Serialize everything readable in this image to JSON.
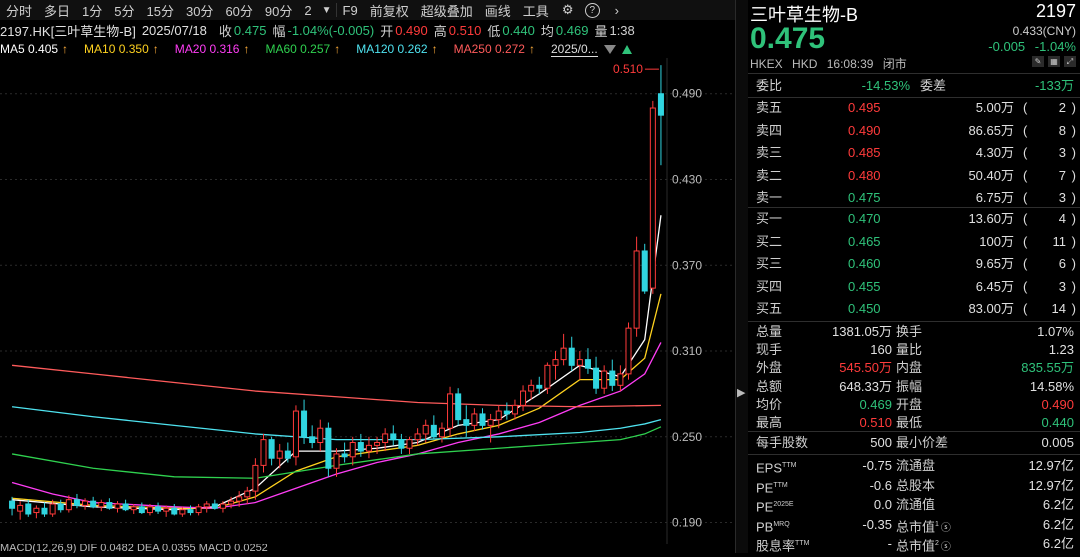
{
  "toolbar": {
    "items": [
      "分时",
      "多日",
      "1分",
      "5分",
      "15分",
      "30分",
      "60分",
      "90分",
      "2"
    ],
    "right_items": [
      "F9",
      "前复权",
      "超级叠加",
      "画线",
      "工具"
    ],
    "icons": [
      "gear-icon",
      "help-icon",
      "chevron-right-icon"
    ]
  },
  "info": {
    "symbol": "2197.HK[三叶草生物-B]",
    "date": "2025/07/18",
    "close_label": "收",
    "close": "0.475",
    "chg_label": "幅",
    "chg": "-1.04%(-0.005)",
    "open_label": "开",
    "open": "0.490",
    "high_label": "高",
    "high": "0.510",
    "low_label": "低",
    "low": "0.440",
    "avg_label": "均",
    "avg": "0.469",
    "vol_label": "量",
    "vol": "1:38"
  },
  "ma": [
    {
      "label": "MA5 0.405",
      "color": "#ffffff"
    },
    {
      "label": "MA10 0.350",
      "color": "#ffd21f"
    },
    {
      "label": "MA20 0.316",
      "color": "#ff3df5"
    },
    {
      "label": "MA60 0.257",
      "color": "#2fd14f"
    },
    {
      "label": "MA120 0.262",
      "color": "#4fe3f0"
    },
    {
      "label": "MA250 0.272",
      "color": "#ff5b5b"
    }
  ],
  "ma_arrow": "↑",
  "ma_date": "2025/0...",
  "macd_text": "MACD(12,26,9)  DIF 0.0482  DEA 0.0355  MACD 0.0252",
  "chart_data": {
    "type": "candlestick",
    "ylim": [
      0.175,
      0.515
    ],
    "yticks": [
      0.19,
      0.25,
      0.31,
      0.37,
      0.43,
      0.49
    ],
    "ytick_labels": [
      "0.190",
      "0.250",
      "0.310",
      "0.370",
      "0.430",
      "0.490"
    ],
    "high_label": "0.510",
    "up_color": "#ff3b3b",
    "down_color": "#30d5e0",
    "candles": [
      {
        "o": 0.205,
        "h": 0.208,
        "l": 0.195,
        "c": 0.2
      },
      {
        "o": 0.198,
        "h": 0.205,
        "l": 0.192,
        "c": 0.202
      },
      {
        "o": 0.203,
        "h": 0.206,
        "l": 0.194,
        "c": 0.196
      },
      {
        "o": 0.197,
        "h": 0.202,
        "l": 0.193,
        "c": 0.2
      },
      {
        "o": 0.2,
        "h": 0.204,
        "l": 0.194,
        "c": 0.196
      },
      {
        "o": 0.196,
        "h": 0.206,
        "l": 0.194,
        "c": 0.203
      },
      {
        "o": 0.203,
        "h": 0.206,
        "l": 0.197,
        "c": 0.199
      },
      {
        "o": 0.199,
        "h": 0.209,
        "l": 0.197,
        "c": 0.206
      },
      {
        "o": 0.206,
        "h": 0.21,
        "l": 0.2,
        "c": 0.202
      },
      {
        "o": 0.202,
        "h": 0.207,
        "l": 0.199,
        "c": 0.205
      },
      {
        "o": 0.205,
        "h": 0.208,
        "l": 0.2,
        "c": 0.201
      },
      {
        "o": 0.201,
        "h": 0.206,
        "l": 0.198,
        "c": 0.204
      },
      {
        "o": 0.204,
        "h": 0.207,
        "l": 0.199,
        "c": 0.2
      },
      {
        "o": 0.2,
        "h": 0.205,
        "l": 0.197,
        "c": 0.203
      },
      {
        "o": 0.203,
        "h": 0.206,
        "l": 0.198,
        "c": 0.199
      },
      {
        "o": 0.199,
        "h": 0.203,
        "l": 0.196,
        "c": 0.201
      },
      {
        "o": 0.201,
        "h": 0.204,
        "l": 0.196,
        "c": 0.197
      },
      {
        "o": 0.197,
        "h": 0.203,
        "l": 0.195,
        "c": 0.201
      },
      {
        "o": 0.201,
        "h": 0.204,
        "l": 0.196,
        "c": 0.198
      },
      {
        "o": 0.198,
        "h": 0.202,
        "l": 0.194,
        "c": 0.2
      },
      {
        "o": 0.2,
        "h": 0.203,
        "l": 0.195,
        "c": 0.196
      },
      {
        "o": 0.196,
        "h": 0.201,
        "l": 0.194,
        "c": 0.199
      },
      {
        "o": 0.199,
        "h": 0.202,
        "l": 0.195,
        "c": 0.197
      },
      {
        "o": 0.197,
        "h": 0.203,
        "l": 0.195,
        "c": 0.201
      },
      {
        "o": 0.201,
        "h": 0.205,
        "l": 0.197,
        "c": 0.203
      },
      {
        "o": 0.203,
        "h": 0.206,
        "l": 0.199,
        "c": 0.2
      },
      {
        "o": 0.2,
        "h": 0.205,
        "l": 0.197,
        "c": 0.203
      },
      {
        "o": 0.203,
        "h": 0.208,
        "l": 0.2,
        "c": 0.205
      },
      {
        "o": 0.205,
        "h": 0.212,
        "l": 0.201,
        "c": 0.208
      },
      {
        "o": 0.208,
        "h": 0.215,
        "l": 0.203,
        "c": 0.212
      },
      {
        "o": 0.212,
        "h": 0.235,
        "l": 0.206,
        "c": 0.23
      },
      {
        "o": 0.23,
        "h": 0.252,
        "l": 0.225,
        "c": 0.248
      },
      {
        "o": 0.248,
        "h": 0.25,
        "l": 0.23,
        "c": 0.235
      },
      {
        "o": 0.235,
        "h": 0.245,
        "l": 0.228,
        "c": 0.24
      },
      {
        "o": 0.24,
        "h": 0.246,
        "l": 0.232,
        "c": 0.235
      },
      {
        "o": 0.236,
        "h": 0.272,
        "l": 0.23,
        "c": 0.268
      },
      {
        "o": 0.268,
        "h": 0.276,
        "l": 0.245,
        "c": 0.25
      },
      {
        "o": 0.25,
        "h": 0.258,
        "l": 0.242,
        "c": 0.246
      },
      {
        "o": 0.246,
        "h": 0.262,
        "l": 0.24,
        "c": 0.256
      },
      {
        "o": 0.256,
        "h": 0.26,
        "l": 0.222,
        "c": 0.228
      },
      {
        "o": 0.228,
        "h": 0.242,
        "l": 0.222,
        "c": 0.238
      },
      {
        "o": 0.238,
        "h": 0.246,
        "l": 0.232,
        "c": 0.236
      },
      {
        "o": 0.236,
        "h": 0.25,
        "l": 0.23,
        "c": 0.246
      },
      {
        "o": 0.246,
        "h": 0.252,
        "l": 0.236,
        "c": 0.24
      },
      {
        "o": 0.24,
        "h": 0.25,
        "l": 0.235,
        "c": 0.244
      },
      {
        "o": 0.244,
        "h": 0.25,
        "l": 0.238,
        "c": 0.246
      },
      {
        "o": 0.246,
        "h": 0.256,
        "l": 0.24,
        "c": 0.252
      },
      {
        "o": 0.252,
        "h": 0.258,
        "l": 0.244,
        "c": 0.248
      },
      {
        "o": 0.248,
        "h": 0.252,
        "l": 0.238,
        "c": 0.242
      },
      {
        "o": 0.242,
        "h": 0.25,
        "l": 0.238,
        "c": 0.248
      },
      {
        "o": 0.248,
        "h": 0.256,
        "l": 0.244,
        "c": 0.252
      },
      {
        "o": 0.252,
        "h": 0.262,
        "l": 0.246,
        "c": 0.258
      },
      {
        "o": 0.258,
        "h": 0.265,
        "l": 0.248,
        "c": 0.25
      },
      {
        "o": 0.25,
        "h": 0.26,
        "l": 0.246,
        "c": 0.256
      },
      {
        "o": 0.256,
        "h": 0.285,
        "l": 0.25,
        "c": 0.28
      },
      {
        "o": 0.28,
        "h": 0.284,
        "l": 0.258,
        "c": 0.262
      },
      {
        "o": 0.262,
        "h": 0.272,
        "l": 0.25,
        "c": 0.258
      },
      {
        "o": 0.258,
        "h": 0.27,
        "l": 0.254,
        "c": 0.266
      },
      {
        "o": 0.266,
        "h": 0.27,
        "l": 0.255,
        "c": 0.258
      },
      {
        "o": 0.258,
        "h": 0.266,
        "l": 0.246,
        "c": 0.262
      },
      {
        "o": 0.262,
        "h": 0.272,
        "l": 0.256,
        "c": 0.268
      },
      {
        "o": 0.268,
        "h": 0.274,
        "l": 0.262,
        "c": 0.266
      },
      {
        "o": 0.266,
        "h": 0.276,
        "l": 0.262,
        "c": 0.272
      },
      {
        "o": 0.272,
        "h": 0.286,
        "l": 0.268,
        "c": 0.282
      },
      {
        "o": 0.282,
        "h": 0.29,
        "l": 0.276,
        "c": 0.286
      },
      {
        "o": 0.286,
        "h": 0.292,
        "l": 0.28,
        "c": 0.284
      },
      {
        "o": 0.284,
        "h": 0.302,
        "l": 0.28,
        "c": 0.3
      },
      {
        "o": 0.3,
        "h": 0.31,
        "l": 0.29,
        "c": 0.304
      },
      {
        "o": 0.304,
        "h": 0.322,
        "l": 0.3,
        "c": 0.312
      },
      {
        "o": 0.312,
        "h": 0.32,
        "l": 0.296,
        "c": 0.3
      },
      {
        "o": 0.3,
        "h": 0.31,
        "l": 0.29,
        "c": 0.304
      },
      {
        "o": 0.304,
        "h": 0.312,
        "l": 0.294,
        "c": 0.298
      },
      {
        "o": 0.298,
        "h": 0.306,
        "l": 0.28,
        "c": 0.284
      },
      {
        "o": 0.284,
        "h": 0.3,
        "l": 0.28,
        "c": 0.296
      },
      {
        "o": 0.296,
        "h": 0.304,
        "l": 0.282,
        "c": 0.286
      },
      {
        "o": 0.286,
        "h": 0.3,
        "l": 0.282,
        "c": 0.294
      },
      {
        "o": 0.294,
        "h": 0.33,
        "l": 0.29,
        "c": 0.326
      },
      {
        "o": 0.326,
        "h": 0.39,
        "l": 0.32,
        "c": 0.38
      },
      {
        "o": 0.38,
        "h": 0.385,
        "l": 0.35,
        "c": 0.352
      },
      {
        "o": 0.354,
        "h": 0.485,
        "l": 0.35,
        "c": 0.48
      },
      {
        "o": 0.49,
        "h": 0.51,
        "l": 0.44,
        "c": 0.475
      }
    ],
    "ma_lines": [
      {
        "name": "MA5",
        "color": "#ffffff",
        "values": [
          [
            0,
            0.206
          ],
          [
            10,
            0.201
          ],
          [
            20,
            0.199
          ],
          [
            25,
            0.201
          ],
          [
            30,
            0.214
          ],
          [
            35,
            0.24
          ],
          [
            40,
            0.24
          ],
          [
            45,
            0.242
          ],
          [
            50,
            0.246
          ],
          [
            55,
            0.258
          ],
          [
            60,
            0.262
          ],
          [
            65,
            0.28
          ],
          [
            70,
            0.3
          ],
          [
            75,
            0.292
          ],
          [
            78,
            0.318
          ],
          [
            80,
            0.405
          ]
        ]
      },
      {
        "name": "MA10",
        "color": "#ffd21f",
        "values": [
          [
            0,
            0.207
          ],
          [
            10,
            0.202
          ],
          [
            20,
            0.2
          ],
          [
            25,
            0.2
          ],
          [
            30,
            0.208
          ],
          [
            35,
            0.226
          ],
          [
            40,
            0.236
          ],
          [
            45,
            0.24
          ],
          [
            50,
            0.244
          ],
          [
            55,
            0.252
          ],
          [
            60,
            0.258
          ],
          [
            65,
            0.27
          ],
          [
            70,
            0.29
          ],
          [
            75,
            0.29
          ],
          [
            78,
            0.305
          ],
          [
            80,
            0.35
          ]
        ]
      },
      {
        "name": "MA20",
        "color": "#ff3df5",
        "values": [
          [
            0,
            0.218
          ],
          [
            5,
            0.21
          ],
          [
            10,
            0.204
          ],
          [
            20,
            0.201
          ],
          [
            25,
            0.2
          ],
          [
            30,
            0.204
          ],
          [
            35,
            0.214
          ],
          [
            40,
            0.224
          ],
          [
            45,
            0.232
          ],
          [
            50,
            0.238
          ],
          [
            55,
            0.246
          ],
          [
            60,
            0.252
          ],
          [
            65,
            0.26
          ],
          [
            70,
            0.272
          ],
          [
            75,
            0.282
          ],
          [
            78,
            0.294
          ],
          [
            80,
            0.316
          ]
        ]
      },
      {
        "name": "MA60",
        "color": "#2fd14f",
        "values": [
          [
            0,
            0.238
          ],
          [
            10,
            0.228
          ],
          [
            20,
            0.222
          ],
          [
            30,
            0.221
          ],
          [
            40,
            0.23
          ],
          [
            50,
            0.238
          ],
          [
            60,
            0.242
          ],
          [
            65,
            0.244
          ],
          [
            70,
            0.246
          ],
          [
            75,
            0.248
          ],
          [
            78,
            0.252
          ],
          [
            80,
            0.257
          ]
        ]
      },
      {
        "name": "MA120",
        "color": "#4fe3f0",
        "values": [
          [
            0,
            0.271
          ],
          [
            10,
            0.264
          ],
          [
            20,
            0.258
          ],
          [
            30,
            0.252
          ],
          [
            40,
            0.248
          ],
          [
            50,
            0.248
          ],
          [
            60,
            0.25
          ],
          [
            70,
            0.253
          ],
          [
            75,
            0.256
          ],
          [
            78,
            0.259
          ],
          [
            80,
            0.262
          ]
        ]
      },
      {
        "name": "MA250",
        "color": "#ff5b5b",
        "values": [
          [
            0,
            0.3
          ],
          [
            10,
            0.294
          ],
          [
            20,
            0.288
          ],
          [
            30,
            0.282
          ],
          [
            40,
            0.278
          ],
          [
            50,
            0.274
          ],
          [
            60,
            0.272
          ],
          [
            70,
            0.271
          ],
          [
            80,
            0.272
          ]
        ]
      }
    ]
  },
  "panel": {
    "name": "三叶草生物-B",
    "code": "2197",
    "price": "0.475",
    "prev": "0.433(CNY)",
    "chg": "-0.005",
    "chg_pct": "-1.04%",
    "exchange": "HKEX",
    "currency": "HKD",
    "time": "16:08:39",
    "status": "闭市",
    "weibi_label": "委比",
    "weibi": "-14.53%",
    "weicha_label": "委差",
    "weicha": "-133万",
    "asks": [
      {
        "label": "卖五",
        "price": "0.495",
        "vol": "5.00万",
        "cnt": "2",
        "color": "red"
      },
      {
        "label": "卖四",
        "price": "0.490",
        "vol": "86.65万",
        "cnt": "8",
        "color": "red"
      },
      {
        "label": "卖三",
        "price": "0.485",
        "vol": "4.30万",
        "cnt": "3",
        "color": "red"
      },
      {
        "label": "卖二",
        "price": "0.480",
        "vol": "50.40万",
        "cnt": "7",
        "color": "red"
      },
      {
        "label": "卖一",
        "price": "0.475",
        "vol": "6.75万",
        "cnt": "3",
        "color": "green"
      }
    ],
    "bids": [
      {
        "label": "买一",
        "price": "0.470",
        "vol": "13.60万",
        "cnt": "4",
        "color": "green"
      },
      {
        "label": "买二",
        "price": "0.465",
        "vol": "100万",
        "cnt": "11",
        "color": "green"
      },
      {
        "label": "买三",
        "price": "0.460",
        "vol": "9.65万",
        "cnt": "6",
        "color": "green"
      },
      {
        "label": "买四",
        "price": "0.455",
        "vol": "6.45万",
        "cnt": "3",
        "color": "green"
      },
      {
        "label": "买五",
        "price": "0.450",
        "vol": "83.00万",
        "cnt": "14",
        "color": "green"
      }
    ],
    "stats": [
      {
        "l1": "总量",
        "v1": "1381.05万",
        "c1": "white",
        "l2": "换手",
        "v2": "1.07%",
        "c2": "white"
      },
      {
        "l1": "现手",
        "v1": "160",
        "c1": "white",
        "l2": "量比",
        "v2": "1.23",
        "c2": "white"
      },
      {
        "l1": "外盘",
        "v1": "545.50万",
        "c1": "red",
        "l2": "内盘",
        "v2": "835.55万",
        "c2": "green"
      },
      {
        "l1": "总额",
        "v1": "648.33万",
        "c1": "white",
        "l2": "振幅",
        "v2": "14.58%",
        "c2": "white"
      },
      {
        "l1": "均价",
        "v1": "0.469",
        "c1": "green",
        "l2": "开盘",
        "v2": "0.490",
        "c2": "red"
      },
      {
        "l1": "最高",
        "v1": "0.510",
        "c1": "red",
        "l2": "最低",
        "v2": "0.440",
        "c2": "green"
      }
    ],
    "lot": {
      "l1": "每手股数",
      "v1": "500",
      "l2": "最小价差",
      "v2": "0.005"
    },
    "fund": [
      {
        "l1": "EPS",
        "s1": "TTM",
        "v1": "-0.75",
        "l2": "流通盘",
        "s2": "",
        "v2": "12.97亿"
      },
      {
        "l1": "PE",
        "s1": "TTM",
        "v1": "-0.6",
        "l2": "总股本",
        "s2": "",
        "v2": "12.97亿"
      },
      {
        "l1": "PE",
        "s1": "2025E",
        "v1": "0.0",
        "l2": "流通值",
        "s2": "",
        "v2": "6.2亿"
      },
      {
        "l1": "PB",
        "s1": "MRQ",
        "v1": "-0.35",
        "l2": "总市值",
        "s2": "1",
        "v2": "6.2亿"
      },
      {
        "l1": "股息率",
        "s1": "TTM",
        "v1": "-",
        "l2": "总市值",
        "s2": "2",
        "v2": "6.2亿"
      }
    ]
  }
}
